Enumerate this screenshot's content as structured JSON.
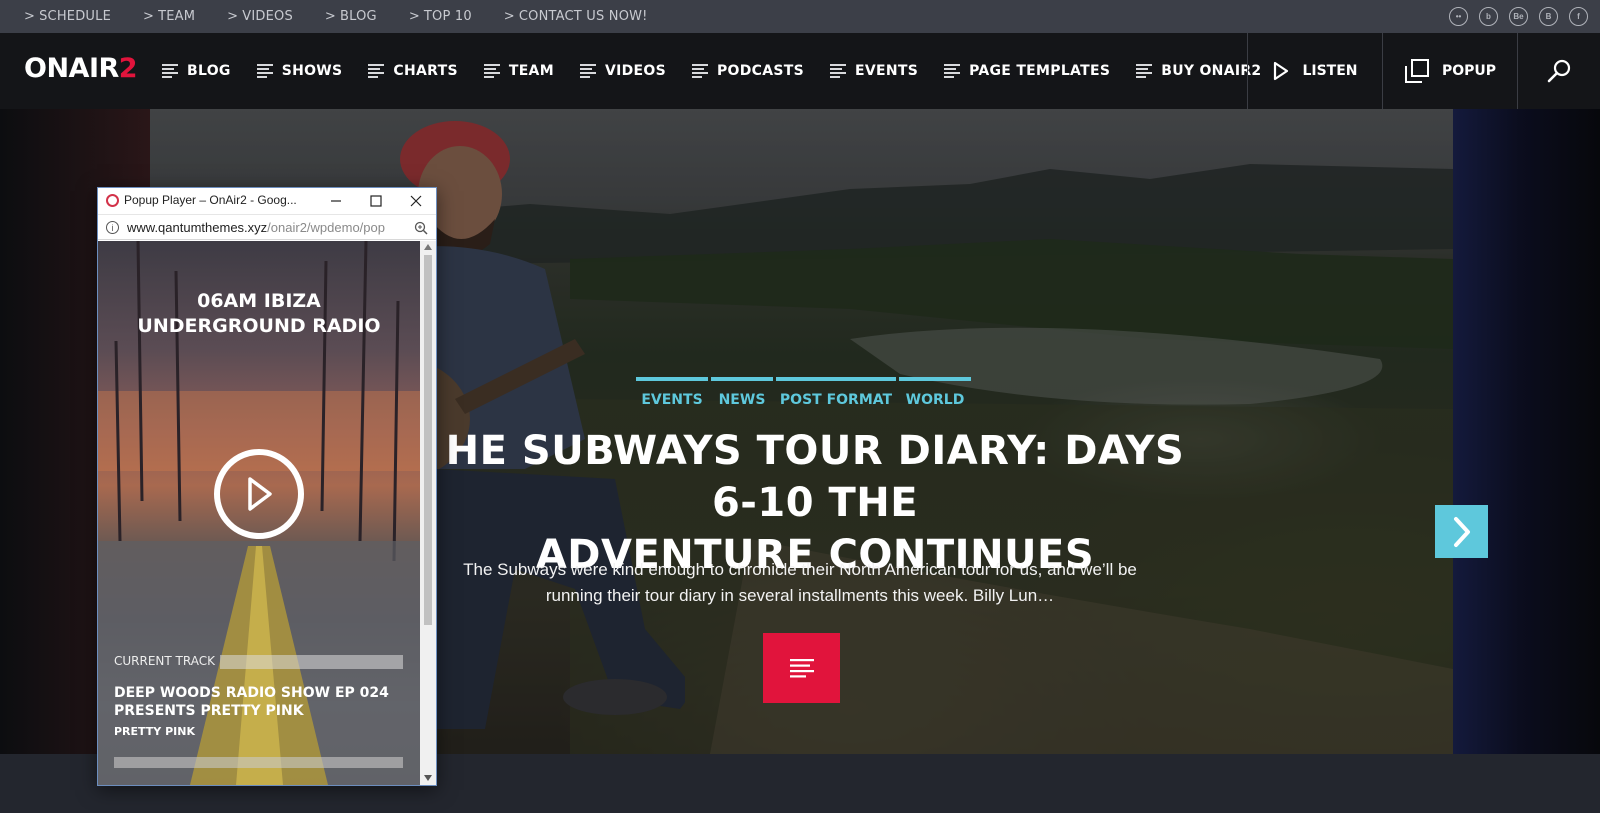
{
  "topbar": {
    "links": [
      "SCHEDULE",
      "TEAM",
      "VIDEOS",
      "BLOG",
      "TOP 10",
      "CONTACT US NOW!"
    ],
    "social": [
      "flickr-icon",
      "blogger-icon",
      "behance-icon",
      "blogger-alt-icon",
      "facebook-icon"
    ]
  },
  "nav": {
    "logo_main": "ONAIR",
    "logo_accent": "2",
    "items": [
      "BLOG",
      "SHOWS",
      "CHARTS",
      "TEAM",
      "VIDEOS",
      "PODCASTS",
      "EVENTS",
      "PAGE TEMPLATES",
      "BUY ONAIR2"
    ],
    "listen_label": "LISTEN",
    "popup_label": "POPUP"
  },
  "slide": {
    "categories": [
      "EVENTS",
      "NEWS",
      "POST FORMAT",
      "WORLD"
    ],
    "title": "HE SUBWAYS TOUR DIARY: DAYS 6-10 THE\nADVENTURE CONTINUES",
    "excerpt": "The Subways were kind enough to chronicle their North American tour for us, and we’ll be running their tour diary in several installments this week. Billy Lun…",
    "active_dot": 5,
    "dot_count": 5
  },
  "popup": {
    "window_title": "Popup Player – OnAir2 - Goog...",
    "url_host": "www.qantumthemes.xyz",
    "url_path": "/onair2/wpdemo/pop",
    "station": "06AM IBIZA\nUNDERGROUND RADIO",
    "current_track_label": "CURRENT TRACK",
    "track_title": "DEEP WOODS RADIO SHOW EP 024\nPRESENTS PRETTY PINK",
    "artist": "PRETTY PINK"
  },
  "colors": {
    "accent_red": "#e1143c",
    "accent_cyan": "#5ec8dc",
    "nav_bg": "#141518",
    "topbar_bg": "#3c3f48"
  }
}
